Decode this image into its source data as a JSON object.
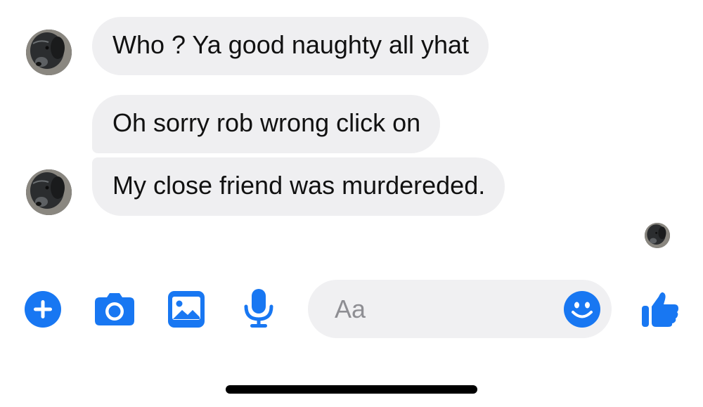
{
  "messages": [
    {
      "text": "Who  ? Ya good naughty all yhat"
    },
    {
      "text": "Oh sorry rob wrong click on"
    },
    {
      "text": "My close friend was murdereded."
    }
  ],
  "composer": {
    "placeholder": "Aa"
  },
  "icons": {
    "add": "plus-icon",
    "camera": "camera-icon",
    "gallery": "image-icon",
    "voice": "microphone-icon",
    "emoji": "smiley-icon",
    "like": "thumbs-up-icon"
  },
  "colors": {
    "accent": "#1877f2",
    "bubble": "#efeff1",
    "composer": "#f0f0f2"
  }
}
